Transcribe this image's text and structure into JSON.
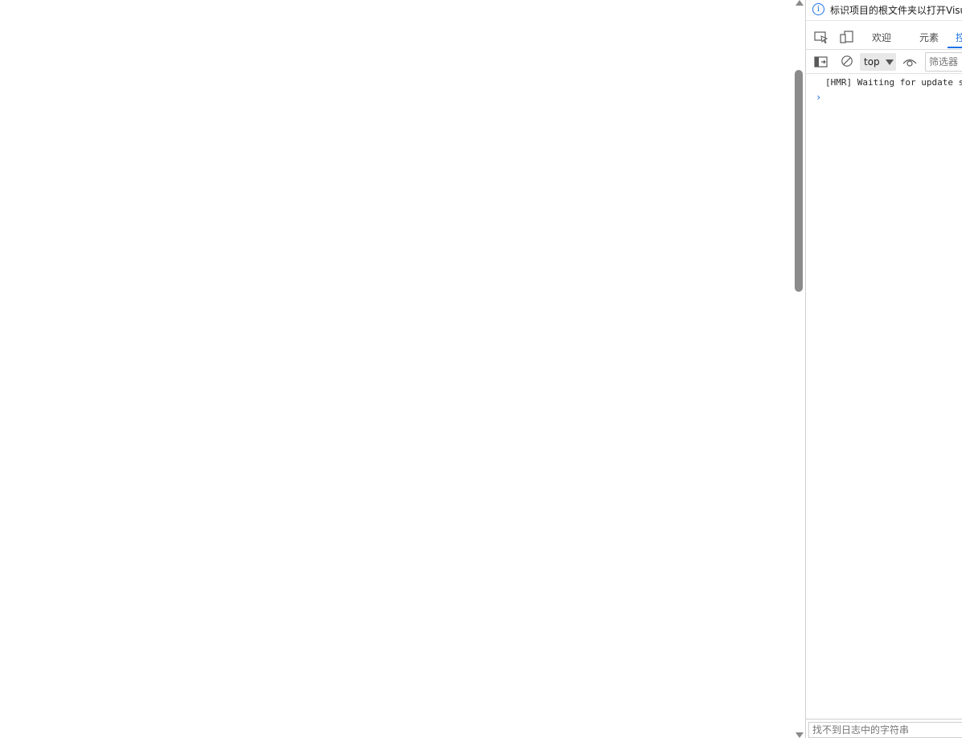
{
  "infobar": {
    "icon": "info-icon",
    "text": "标识项目的根文件夹以打开Visu"
  },
  "tabs": {
    "inspect_icon": "inspect-element-icon",
    "device_icon": "device-emulation-icon",
    "welcome": "欢迎",
    "elements": "元素",
    "console_partial": "控",
    "active_tab": "console"
  },
  "console_toolbar": {
    "sidebar_icon": "console-sidebar-icon",
    "clear_icon": "clear-console-icon",
    "context": "top",
    "live_expression_icon": "eye-icon",
    "filter_placeholder": "筛选器"
  },
  "console": {
    "messages": [
      "[HMR] Waiting for update s"
    ],
    "prompt": "›"
  },
  "bottom_search": {
    "placeholder": "找不到日志中的字符串"
  },
  "colors": {
    "accent": "#1a73e8",
    "scroll_thumb": "#8b8b8b"
  }
}
